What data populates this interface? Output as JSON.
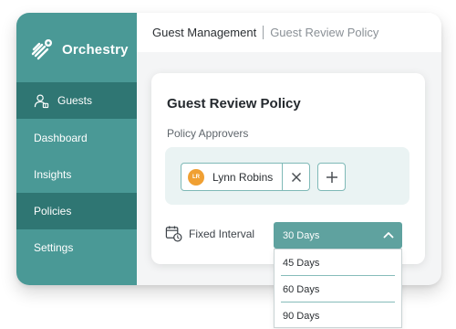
{
  "app": {
    "name": "Orchestry",
    "logo_icon": "orchestry-logo-icon"
  },
  "sidebar": {
    "items": [
      {
        "label": "Guests",
        "icon": "user-icon",
        "active": true
      },
      {
        "label": "Dashboard"
      },
      {
        "label": "Insights"
      },
      {
        "label": "Policies"
      },
      {
        "label": "Settings"
      }
    ]
  },
  "breadcrumb": {
    "parent": "Guest Management",
    "current": "Guest Review Policy"
  },
  "card": {
    "title": "Guest Review Policy",
    "approvers_label": "Policy Approvers",
    "approvers": [
      {
        "initials": "LR",
        "name": "Lynn Robins",
        "remove_icon": "close-icon"
      }
    ],
    "add_icon": "plus-icon",
    "interval_label": "Fixed Interval",
    "interval_icon": "calendar-clock-icon"
  },
  "interval_select": {
    "selected": "30 Days",
    "icon": "chevron-up-icon",
    "options": [
      "45 Days",
      "60 Days",
      "90 Days"
    ]
  },
  "colors": {
    "sidebar": "#4a9996",
    "sidebar_active": "#2f7673",
    "accent": "#5fa29f",
    "avatar": "#f0a033"
  }
}
